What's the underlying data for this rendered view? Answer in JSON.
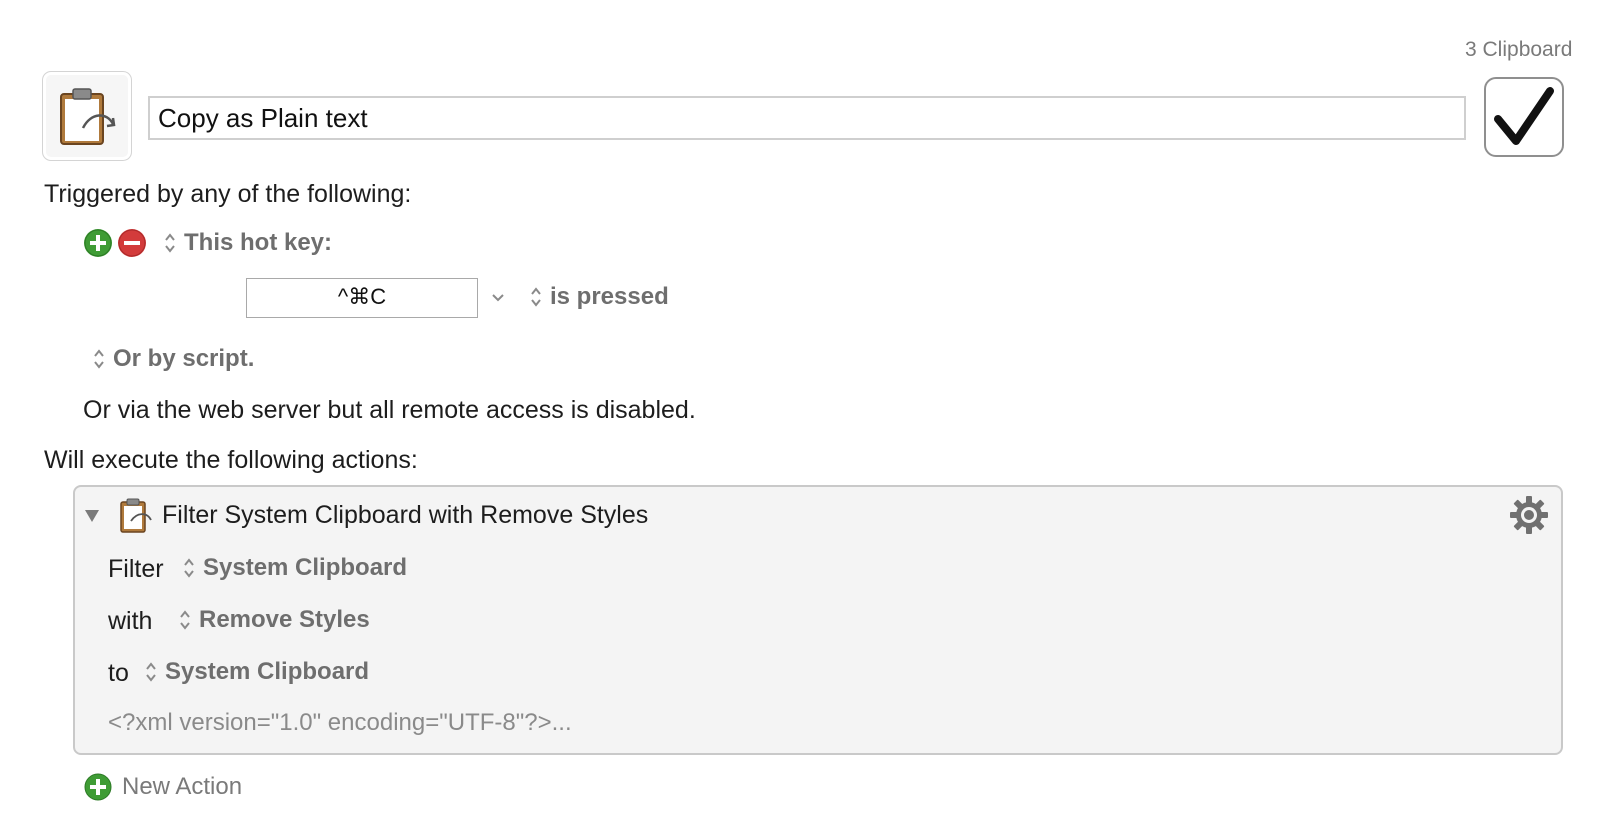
{
  "macro": {
    "group_label": "3 Clipboard",
    "name": "Copy as Plain text",
    "enabled": true
  },
  "triggers": {
    "heading": "Triggered by any of the following:",
    "hotkey_trigger": {
      "type_label": "This hot key:",
      "hotkey": "^⌘C",
      "condition": "is pressed"
    },
    "script_trigger": "Or by script.",
    "web_server_note": "Or via the web server but all remote access is disabled."
  },
  "actions": {
    "heading": "Will execute the following actions:",
    "items": [
      {
        "title": "Filter System Clipboard with Remove Styles",
        "rows": [
          {
            "label": "Filter",
            "value": "System Clipboard"
          },
          {
            "label": "with",
            "value": "Remove Styles"
          },
          {
            "label": "to",
            "value": "System Clipboard"
          }
        ],
        "xml_preview": "<?xml version=\"1.0\" encoding=\"UTF-8\"?>..."
      }
    ],
    "new_action_label": "New Action"
  },
  "icons": {
    "macro_icon": "clipboard-icon",
    "add": "plus-circle-icon",
    "remove": "minus-circle-icon",
    "gear": "gear-icon",
    "disclosure": "disclosure-triangle-icon"
  },
  "colors": {
    "add_green": "#3f9c35",
    "remove_red": "#d33b3b",
    "popup_text": "#6e6e6e"
  }
}
